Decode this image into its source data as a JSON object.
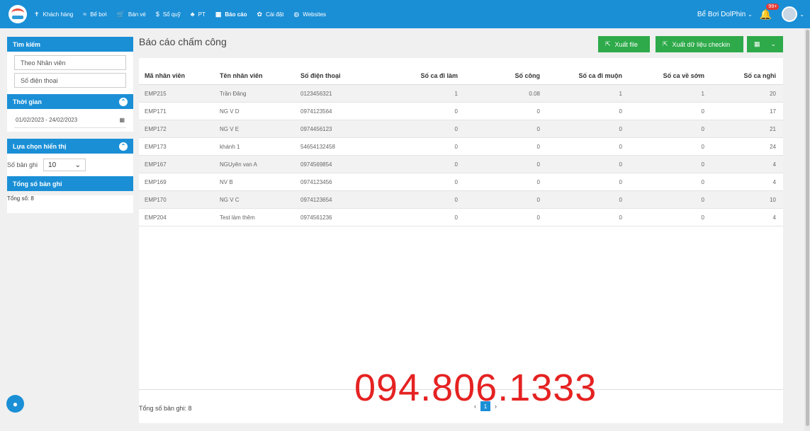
{
  "nav": {
    "items": [
      {
        "icon": "✝",
        "label": "Khách hàng"
      },
      {
        "icon": "≈",
        "label": "Bể bơi"
      },
      {
        "icon": "🛒",
        "label": "Bán vé"
      },
      {
        "icon": "$",
        "label": "Sổ quỹ"
      },
      {
        "icon": "♣",
        "label": "PT"
      },
      {
        "icon": "▦",
        "label": "Báo cáo"
      },
      {
        "icon": "✿",
        "label": "Cài đặt"
      },
      {
        "icon": "◍",
        "label": "Websites"
      }
    ],
    "branch": "Bể Bơi DolPhin",
    "notification_count": "99+"
  },
  "sidebar": {
    "search_header": "Tìm kiếm",
    "employee_placeholder": "Theo Nhân viên",
    "phone_placeholder": "Số điện thoại",
    "time_header": "Thời gian",
    "date_range": "01/02/2023 - 24/02/2023",
    "display_header": "Lựa chọn hiển thị",
    "records_label": "Số bản ghi",
    "records_value": "10",
    "total_header": "Tổng số bản ghi",
    "total_text": "Tổng số: 8"
  },
  "main": {
    "title": "Báo cáo chấm công",
    "export_label": "Xuất file",
    "export_checkin_label": "Xuất dữ liệu checkin",
    "columns": [
      "Mã nhân viên",
      "Tên nhân viên",
      "Số điện thoại",
      "Số ca đi làm",
      "Số công",
      "Số ca đi muộn",
      "Số ca về sớm",
      "Số ca nghỉ"
    ],
    "rows": [
      [
        "EMP215",
        "Trần Đăng",
        "0123456321",
        "1",
        "0.08",
        "1",
        "1",
        "20"
      ],
      [
        "EMP171",
        "NG V D",
        "0974123564",
        "0",
        "0",
        "0",
        "0",
        "17"
      ],
      [
        "EMP172",
        "NG V E",
        "0974456123",
        "0",
        "0",
        "0",
        "0",
        "21"
      ],
      [
        "EMP173",
        "khánh 1",
        "54654132458",
        "0",
        "0",
        "0",
        "0",
        "24"
      ],
      [
        "EMP167",
        "NGUyên van A",
        "0974569854",
        "0",
        "0",
        "0",
        "0",
        "4"
      ],
      [
        "EMP169",
        "NV B",
        "0974123456",
        "0",
        "0",
        "0",
        "0",
        "4"
      ],
      [
        "EMP170",
        "NG V C",
        "0974123654",
        "0",
        "0",
        "0",
        "0",
        "10"
      ],
      [
        "EMP204",
        "Test làm thêm",
        "0974561236",
        "0",
        "0",
        "0",
        "0",
        "4"
      ]
    ],
    "footer_total": "Tổng số bản ghi: 8",
    "current_page": "1"
  },
  "watermark": "094.806.1333",
  "colors": {
    "primary": "#1a8fd6",
    "success": "#2eaa4a",
    "watermark": "#e52222"
  }
}
